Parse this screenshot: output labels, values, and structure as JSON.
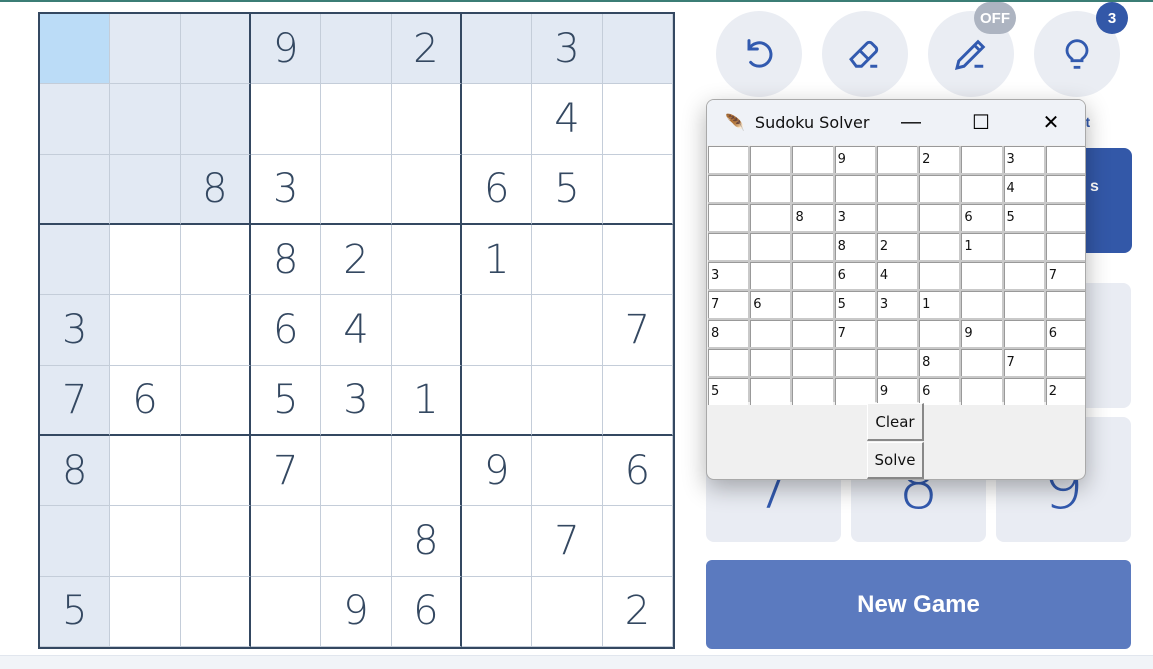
{
  "board": {
    "cells": [
      [
        "",
        "",
        "",
        "9",
        "",
        "2",
        "",
        "3",
        ""
      ],
      [
        "",
        "",
        "",
        "",
        "",
        "",
        "",
        "4",
        ""
      ],
      [
        "",
        "",
        "8",
        "3",
        "",
        "",
        "6",
        "5",
        ""
      ],
      [
        "",
        "",
        "",
        "8",
        "2",
        "",
        "1",
        "",
        ""
      ],
      [
        "3",
        "",
        "",
        "6",
        "4",
        "",
        "",
        "",
        "7"
      ],
      [
        "7",
        "6",
        "",
        "5",
        "3",
        "1",
        "",
        "",
        ""
      ],
      [
        "8",
        "",
        "",
        "7",
        "",
        "",
        "9",
        "",
        "6"
      ],
      [
        "",
        "",
        "",
        "",
        "",
        "8",
        "",
        "7",
        ""
      ],
      [
        "5",
        "",
        "",
        "",
        "9",
        "6",
        "",
        "",
        "2"
      ]
    ],
    "selected": [
      0,
      0
    ]
  },
  "tools": {
    "undo_icon": "undo-icon",
    "erase_icon": "eraser-icon",
    "notes_icon": "pencil-icon",
    "notes_badge": "OFF",
    "hint_icon": "lightbulb-icon",
    "hint_badge": "3",
    "hint_label_visible": "nt",
    "notes_side_text": "s"
  },
  "numpad": {
    "visible_digits": [
      "7",
      "8",
      "9"
    ]
  },
  "new_game_label": "New Game",
  "dialog": {
    "title": "Sudoku Solver",
    "minimize": "—",
    "maximize": "☐",
    "close": "✕",
    "clear_label": "Clear",
    "solve_label": "Solve"
  },
  "colors": {
    "accent": "#325aaf",
    "new_game": "#5b7abf",
    "selected": "#bbdcf7",
    "highlight": "#e2e9f3",
    "grid": "#344861"
  }
}
